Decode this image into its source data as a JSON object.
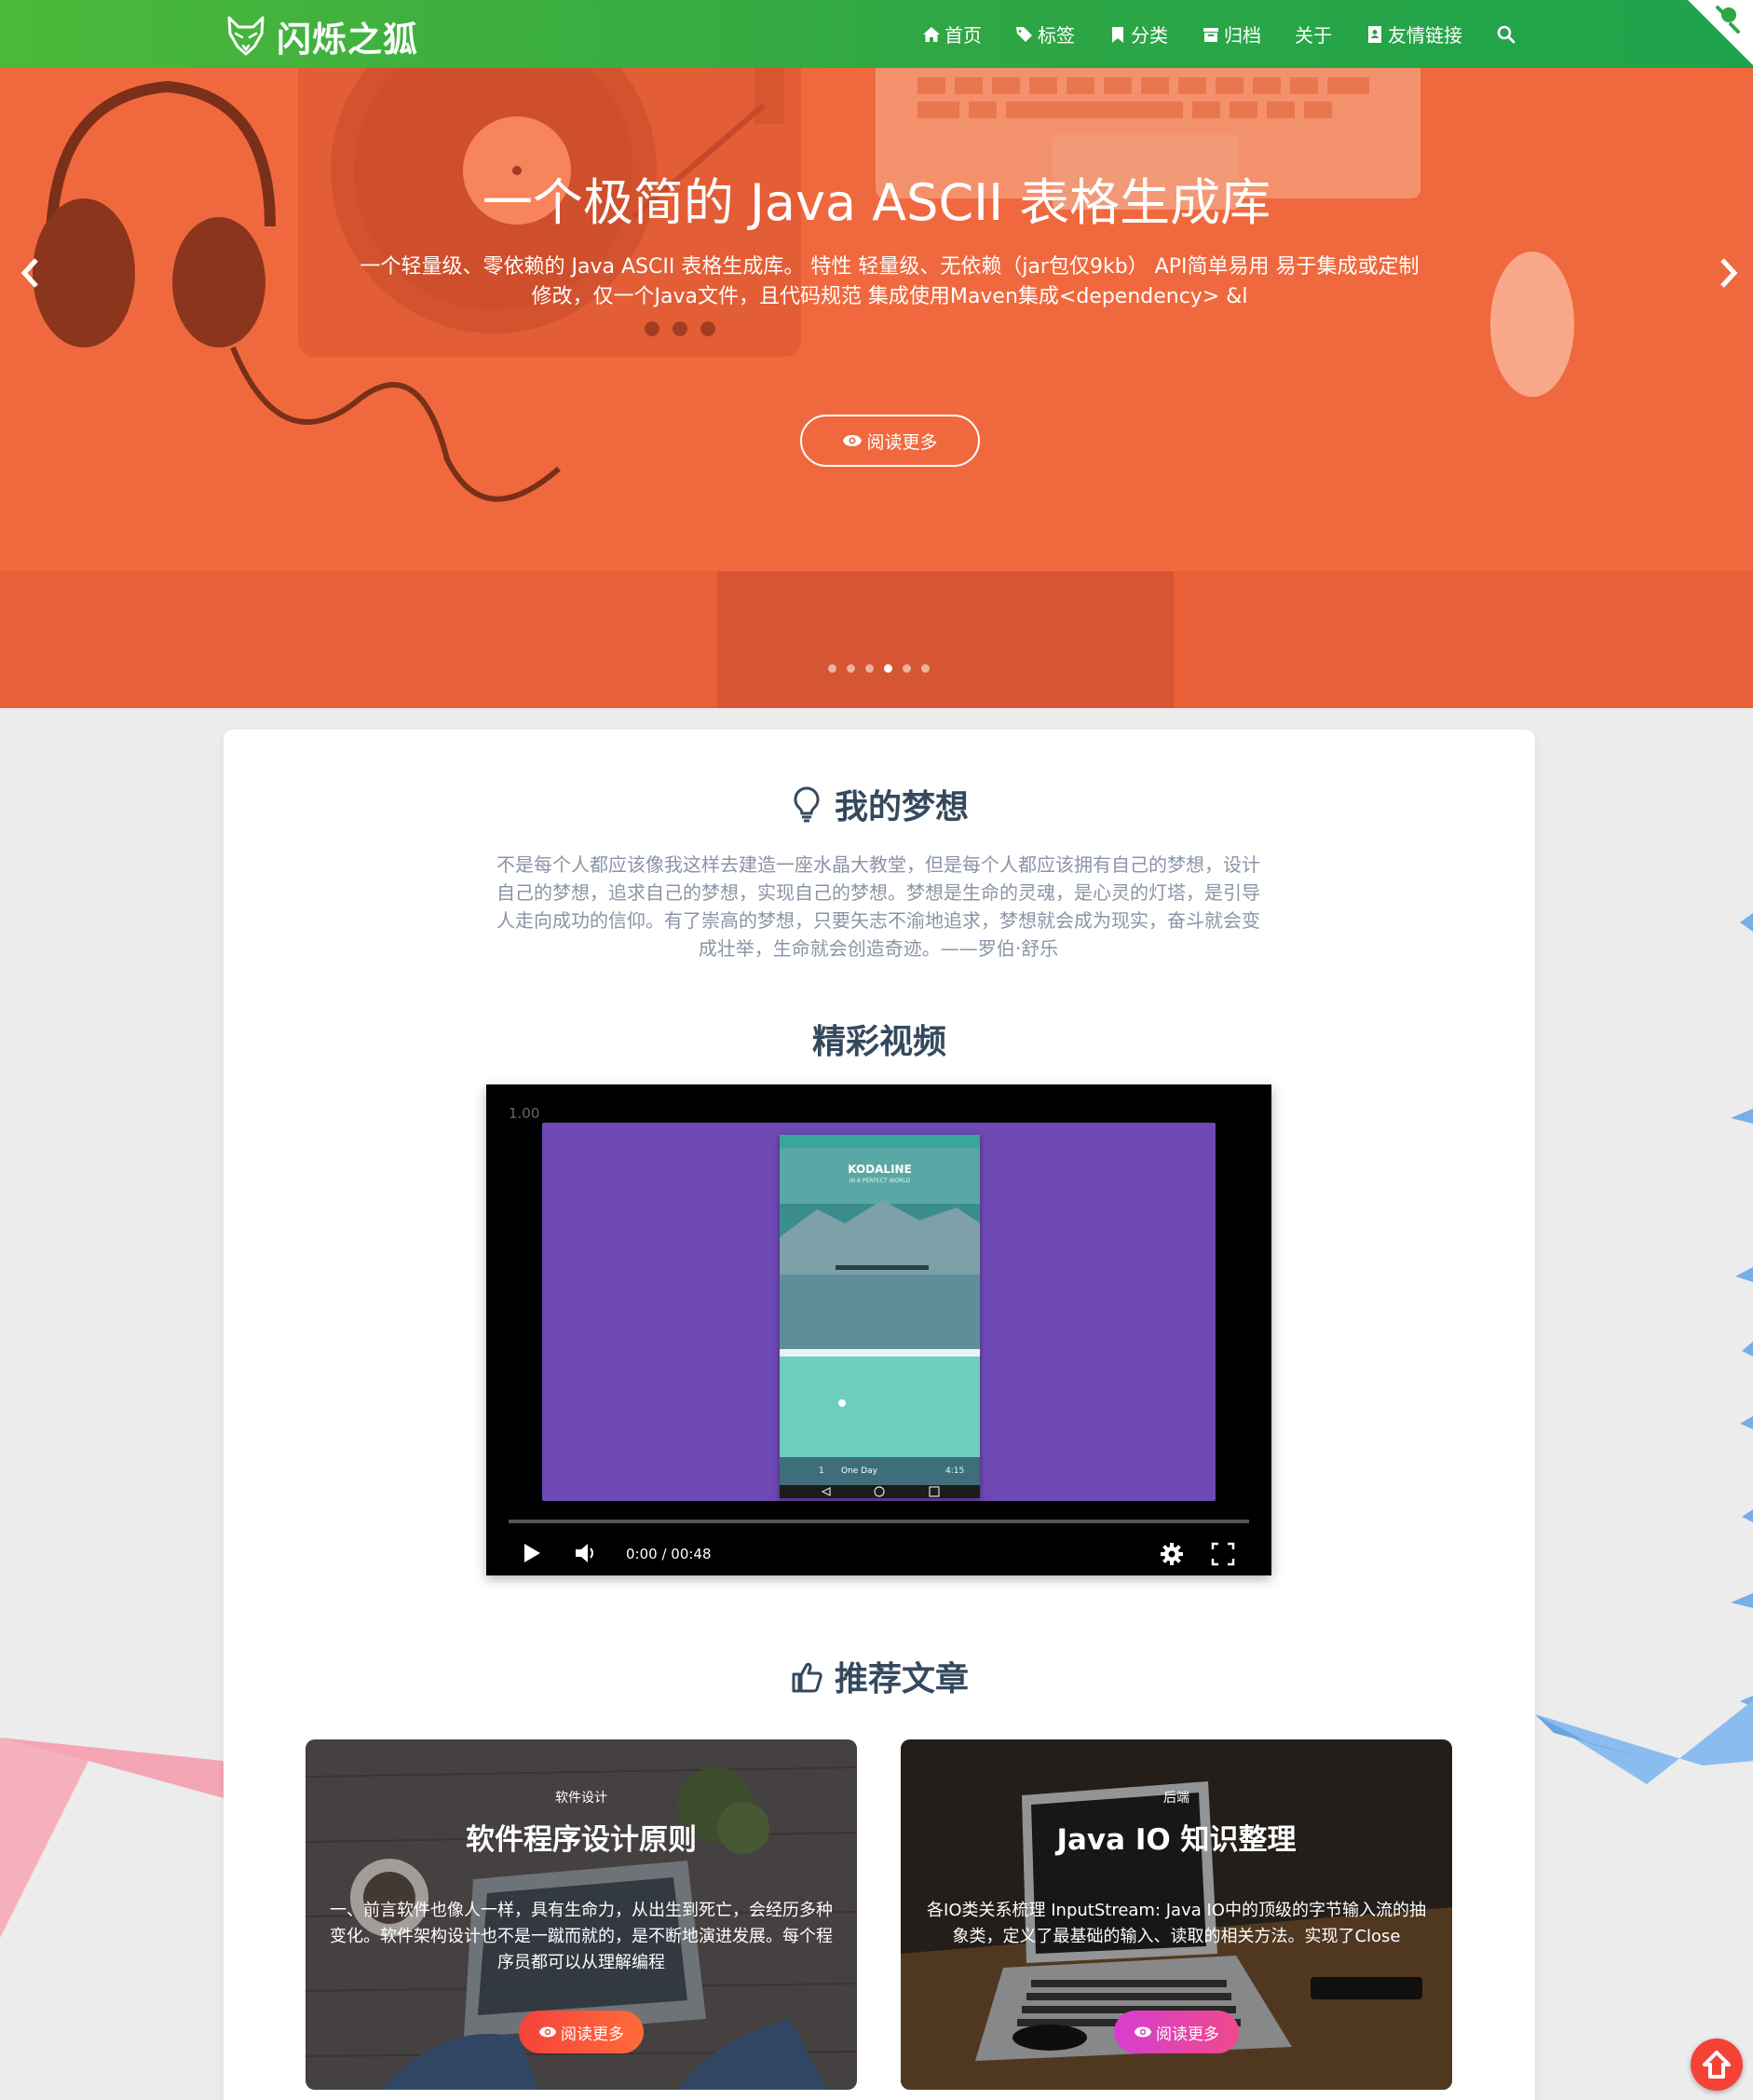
{
  "navbar": {
    "brand_title": "闪烁之狐",
    "items": [
      {
        "icon": "home-icon",
        "label": "首页"
      },
      {
        "icon": "tags-icon",
        "label": "标签"
      },
      {
        "icon": "bookmark-icon",
        "label": "分类"
      },
      {
        "icon": "archive-icon",
        "label": "归档"
      },
      {
        "icon": "",
        "label": "关于"
      },
      {
        "icon": "address-card-icon",
        "label": "友情链接"
      }
    ],
    "search_icon": "search-icon"
  },
  "hero": {
    "title": "一个极简的 Java ASCII 表格生成库",
    "description": "一个轻量级、零依赖的 Java ASCII 表格生成库。 特性 轻量级、无依赖（jar包仅9kb） API简单易用 易于集成或定制修改，仅一个Java文件，且代码规范 集成使用Maven集成<dependency> &l",
    "button_label": "阅读更多",
    "slide_count": 6,
    "active_slide": 4
  },
  "dream": {
    "heading": "我的梦想",
    "text": "不是每个人都应该像我这样去建造一座水晶大教堂，但是每个人都应该拥有自己的梦想，设计自己的梦想，追求自己的梦想，实现自己的梦想。梦想是生命的灵魂，是心灵的灯塔，是引导人走向成功的信仰。有了崇高的梦想，只要矢志不渝地追求，梦想就会成为现实，奋斗就会变成壮举，生命就会创造奇迹。——罗伯·舒乐"
  },
  "video": {
    "heading": "精彩视频",
    "rate": "1.00",
    "time": "0:00 / 00:48",
    "progress": 0,
    "phone_app_title": "KODALINE",
    "phone_subtitle": "IN A PERFECT WORLD",
    "phone_track_number": "1",
    "phone_track_title": "One Day",
    "phone_track_time": "4:15"
  },
  "articles": {
    "heading": "推荐文章",
    "items": [
      {
        "category": "软件设计",
        "title": "软件程序设计原则",
        "excerpt": "一、前言软件也像人一样，具有生命力，从出生到死亡，会经历多种变化。软件架构设计也不是一蹴而就的，是不断地演进发展。每个程序员都可以从理解编程",
        "button_label": "阅读更多",
        "button_color": "#f4433a"
      },
      {
        "category": "后端",
        "title": "Java IO 知识整理",
        "excerpt": "各IO类关系梳理 InputStream: Java IO中的顶级的字节输入流的抽象类，定义了最基础的输入、读取的相关方法。实现了Close",
        "button_label": "阅读更多",
        "button_color": "#d63ed0"
      }
    ]
  },
  "colors": {
    "nav_start": "#4cb83a",
    "nav_end": "#1ea34c",
    "hero_overlay": "#f0693e",
    "back_to_top": "#f44336"
  }
}
